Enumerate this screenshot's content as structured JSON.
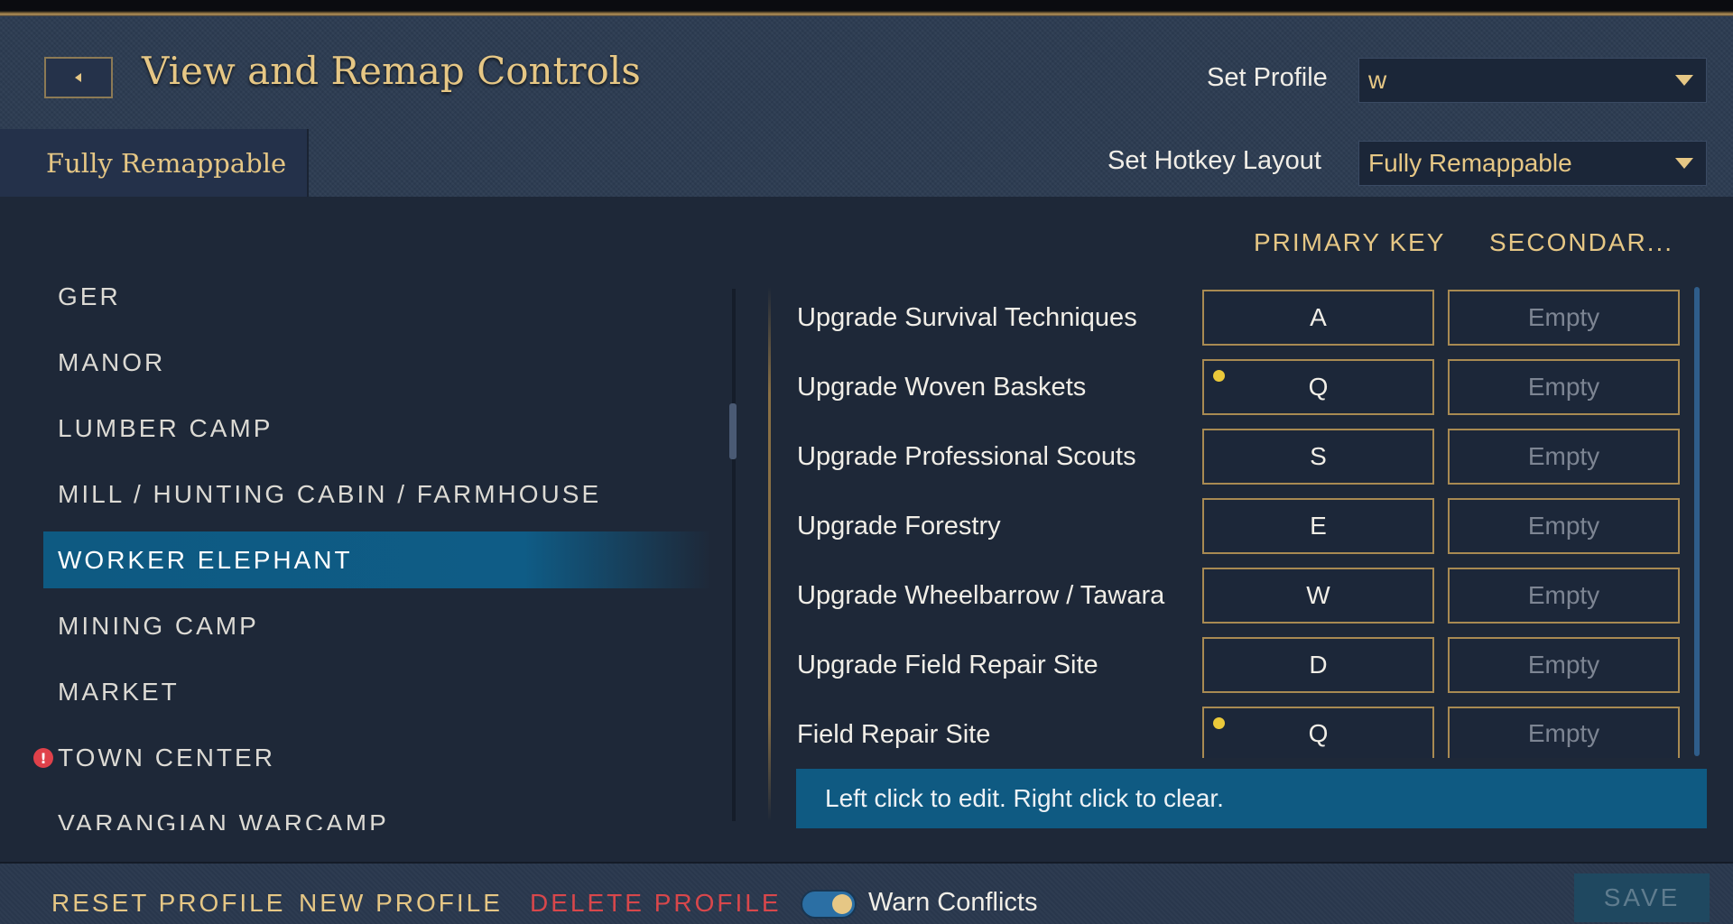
{
  "header": {
    "title": "View and Remap Controls",
    "set_profile_label": "Set Profile",
    "set_profile_value": "w",
    "set_hotkey_layout_label": "Set Hotkey Layout",
    "set_hotkey_layout_value": "Fully Remappable"
  },
  "tabs": [
    {
      "label": "Fully Remappable",
      "active": true
    }
  ],
  "columns": {
    "primary": "PRIMARY KEY",
    "secondary": "SECONDAR..."
  },
  "categories": [
    {
      "label": "GER"
    },
    {
      "label": "MANOR"
    },
    {
      "label": "LUMBER CAMP"
    },
    {
      "label": "MILL / HUNTING CABIN / FARMHOUSE"
    },
    {
      "label": "WORKER ELEPHANT",
      "selected": true
    },
    {
      "label": "MINING CAMP"
    },
    {
      "label": "MARKET"
    },
    {
      "label": "TOWN CENTER",
      "warning": true,
      "warning_symbol": "!"
    },
    {
      "label": "VARANGIAN WARCAMP"
    }
  ],
  "bindings": [
    {
      "action": "Upgrade Survival Techniques",
      "primary": "A",
      "secondary": "Empty",
      "conflict": false
    },
    {
      "action": "Upgrade Woven Baskets",
      "primary": "Q",
      "secondary": "Empty",
      "conflict": true
    },
    {
      "action": "Upgrade Professional Scouts",
      "primary": "S",
      "secondary": "Empty",
      "conflict": false
    },
    {
      "action": "Upgrade Forestry",
      "primary": "E",
      "secondary": "Empty",
      "conflict": false
    },
    {
      "action": "Upgrade Wheelbarrow / Tawara",
      "primary": "W",
      "secondary": "Empty",
      "conflict": false
    },
    {
      "action": "Upgrade Field Repair Site",
      "primary": "D",
      "secondary": "Empty",
      "conflict": false
    },
    {
      "action": "Field Repair Site",
      "primary": "Q",
      "secondary": "Empty",
      "conflict": true
    }
  ],
  "hint": "Left click to edit. Right click to clear.",
  "footer": {
    "reset_profile": "RESET PROFILE",
    "new_profile": "NEW PROFILE",
    "delete_profile": "DELETE PROFILE",
    "warn_conflicts_label": "Warn Conflicts",
    "warn_conflicts_on": true,
    "save": "SAVE"
  },
  "colors": {
    "gold": "#e6c785",
    "highlight": "#0f5c86",
    "danger": "#d8474b",
    "conflict_dot": "#ebc93a"
  },
  "icons": {
    "back": "chevron-left-icon",
    "dropdown": "caret-down-icon",
    "warning": "warning-icon",
    "conflict": "conflict-dot-icon"
  }
}
